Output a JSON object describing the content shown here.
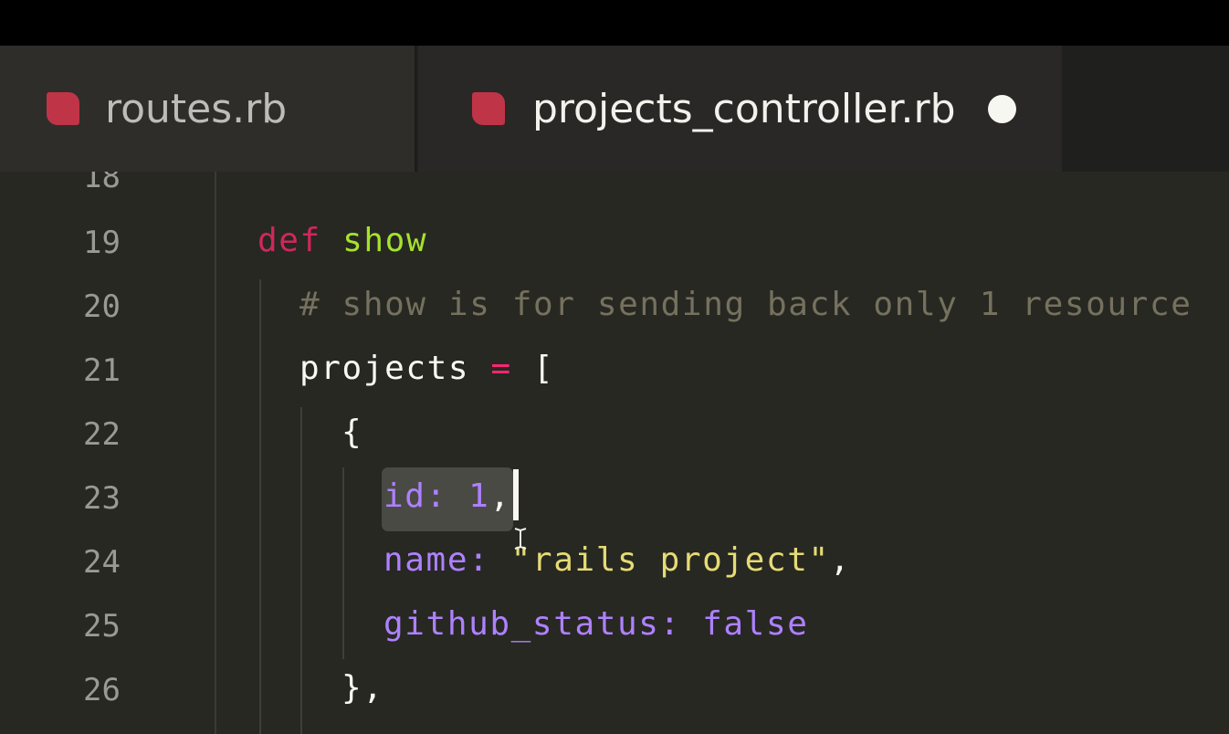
{
  "tabs": [
    {
      "label": "routes.rb",
      "icon": "ruby-file-icon",
      "active": false
    },
    {
      "label": "projects_controller.rb",
      "icon": "ruby-file-icon",
      "active": true,
      "unsaved": true
    }
  ],
  "editor": {
    "lines": [
      {
        "number": "18",
        "tokens": []
      },
      {
        "number": "19",
        "tokens": [
          {
            "type": "kw",
            "text": "def"
          },
          {
            "type": "plain",
            "text": " "
          },
          {
            "type": "fn",
            "text": "show"
          }
        ]
      },
      {
        "number": "20",
        "tokens": [
          {
            "type": "comment",
            "text": "# show is for sending back only 1 resource"
          }
        ]
      },
      {
        "number": "21",
        "tokens": [
          {
            "type": "plain",
            "text": "projects "
          },
          {
            "type": "op",
            "text": "="
          },
          {
            "type": "plain",
            "text": " ["
          }
        ]
      },
      {
        "number": "22",
        "tokens": [
          {
            "type": "plain",
            "text": "{"
          }
        ]
      },
      {
        "number": "23",
        "tokens": [
          {
            "type": "sym",
            "text": "id:"
          },
          {
            "type": "plain",
            "text": " "
          },
          {
            "type": "num",
            "text": "1"
          },
          {
            "type": "plain",
            "text": ","
          }
        ]
      },
      {
        "number": "24",
        "tokens": [
          {
            "type": "sym",
            "text": "name:"
          },
          {
            "type": "plain",
            "text": " "
          },
          {
            "type": "str",
            "text": "\"rails project\""
          },
          {
            "type": "plain",
            "text": ","
          }
        ]
      },
      {
        "number": "25",
        "tokens": [
          {
            "type": "sym",
            "text": "github_status:"
          },
          {
            "type": "plain",
            "text": " "
          },
          {
            "type": "sym",
            "text": "false"
          }
        ]
      },
      {
        "number": "26",
        "tokens": [
          {
            "type": "plain",
            "text": "},"
          }
        ]
      }
    ]
  },
  "colors": {
    "background": "#272822",
    "keyword": "#d0275c",
    "function": "#a6e22e",
    "comment": "#75715e",
    "symbol": "#ae81ff",
    "string": "#e6db74",
    "ruby_icon": "#c03447"
  }
}
